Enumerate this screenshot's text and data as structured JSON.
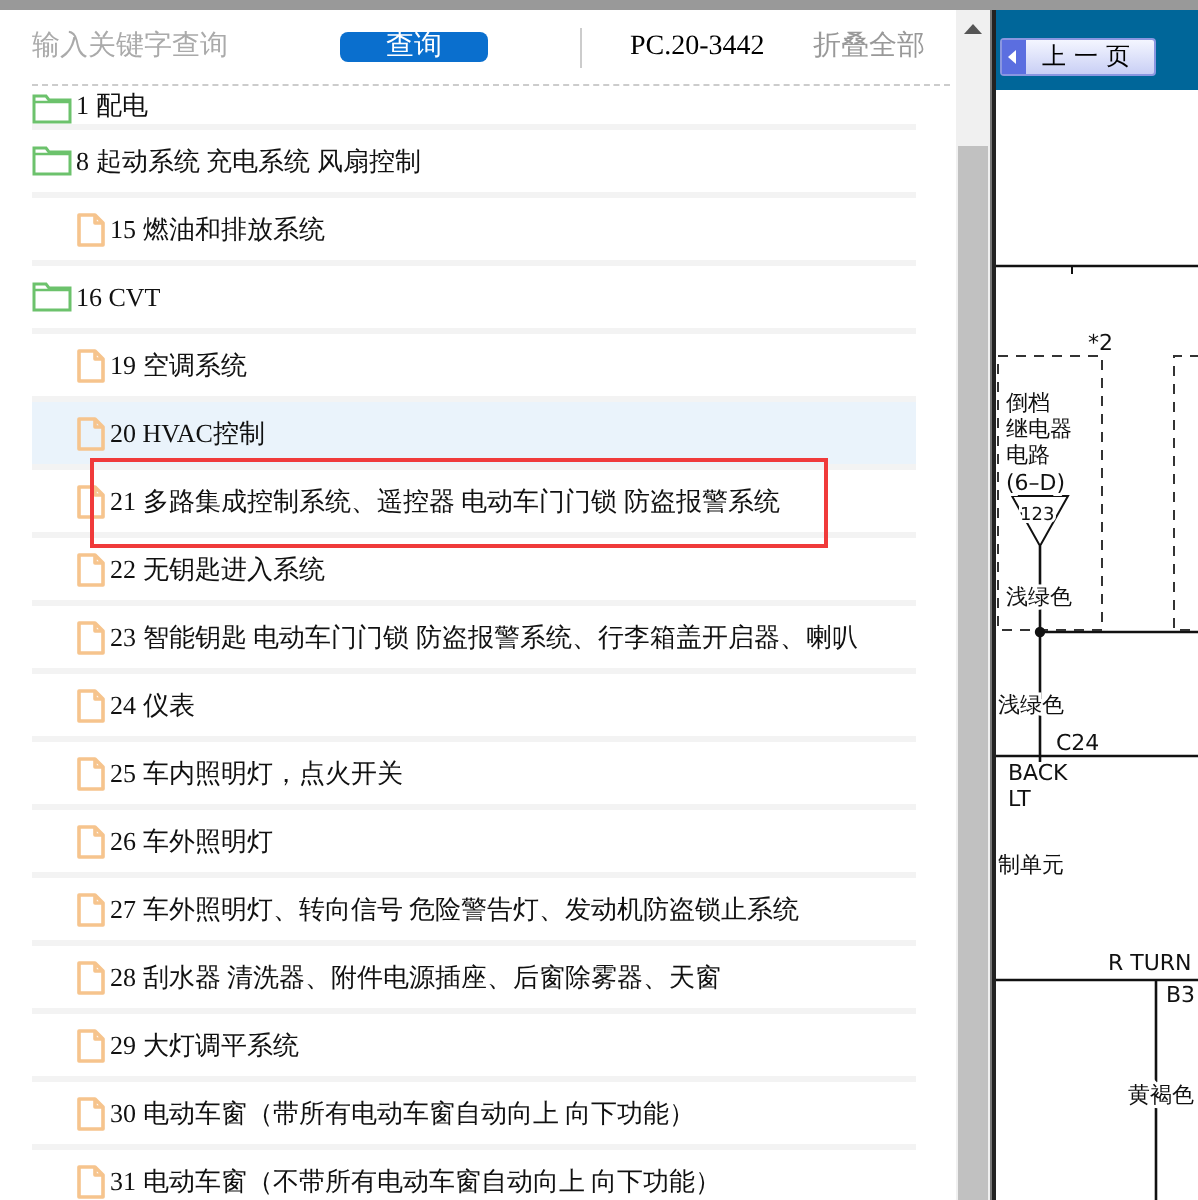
{
  "search": {
    "placeholder": "输入关键字查询",
    "button": "查询"
  },
  "code": "PC.20-3442",
  "collapse": "折叠全部",
  "tree": [
    {
      "label": "1 配电",
      "kind": "folder",
      "selected": false,
      "marked": false
    },
    {
      "label": "8 起动系统 充电系统 风扇控制",
      "kind": "folder",
      "selected": false,
      "marked": false,
      "children": [
        {
          "label": "15 燃油和排放系统",
          "kind": "file",
          "selected": false,
          "marked": false
        }
      ]
    },
    {
      "label": "16 CVT",
      "kind": "folder",
      "selected": false,
      "marked": false,
      "children": [
        {
          "label": "19 空调系统",
          "kind": "file",
          "selected": false,
          "marked": false
        },
        {
          "label": "20 HVAC控制",
          "kind": "file",
          "selected": true,
          "marked": false
        },
        {
          "label": "21 多路集成控制系统、遥控器 电动车门门锁 防盗报警系统",
          "kind": "file",
          "selected": false,
          "marked": true
        },
        {
          "label": "22 无钥匙进入系统",
          "kind": "file",
          "selected": false,
          "marked": false
        },
        {
          "label": "23 智能钥匙 电动车门门锁 防盗报警系统、行李箱盖开启器、喇叭",
          "kind": "file",
          "selected": false,
          "marked": false
        },
        {
          "label": "24 仪表",
          "kind": "file",
          "selected": false,
          "marked": false
        },
        {
          "label": "25 车内照明灯，点火开关",
          "kind": "file",
          "selected": false,
          "marked": false
        },
        {
          "label": "26 车外照明灯",
          "kind": "file",
          "selected": false,
          "marked": false
        },
        {
          "label": "27 车外照明灯、转向信号 危险警告灯、发动机防盗锁止系统",
          "kind": "file",
          "selected": false,
          "marked": false
        },
        {
          "label": "28 刮水器 清洗器、附件电源插座、后窗除雾器、天窗",
          "kind": "file",
          "selected": false,
          "marked": false
        },
        {
          "label": "29 大灯调平系统",
          "kind": "file",
          "selected": false,
          "marked": false
        },
        {
          "label": "30 电动车窗（带所有电动车窗自动向上 向下功能）",
          "kind": "file",
          "selected": false,
          "marked": false
        },
        {
          "label": "31 电动车窗（不带所有电动车窗自动向上 向下功能）",
          "kind": "file",
          "selected": false,
          "marked": false
        }
      ]
    }
  ],
  "viewer": {
    "prev_button": "上一页",
    "diagram_labels": [
      "*2",
      "倒档",
      "继电器",
      "电路",
      "(6–D)",
      "123",
      "浅绿色",
      "浅绿色",
      "C24",
      "BACK",
      "LT",
      "制单元",
      "R TURN",
      "B3",
      "黄褐色"
    ]
  }
}
